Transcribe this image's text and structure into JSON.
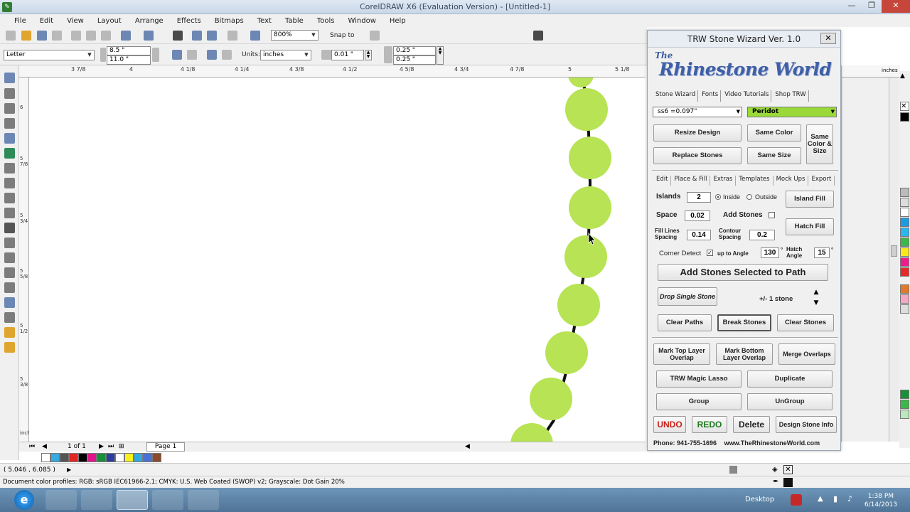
{
  "window": {
    "title": "CorelDRAW X6 (Evaluation Version) - [Untitled-1]",
    "minimize": "—",
    "maximize": "❐",
    "close": "✕"
  },
  "menu": [
    "File",
    "Edit",
    "View",
    "Layout",
    "Arrange",
    "Effects",
    "Bitmaps",
    "Text",
    "Table",
    "Tools",
    "Window",
    "Help"
  ],
  "toolbar": {
    "zoom": "800%",
    "snap_to": "Snap to",
    "page_size": "Letter",
    "width": "8.5 \"",
    "height": "11.0 \"",
    "units_label": "Units:",
    "units": "inches",
    "nudge": "0.01 \"",
    "dup_x": "0.25 \"",
    "dup_y": "0.25 \""
  },
  "ruler": {
    "h_ticks": [
      "3 7/8",
      "4",
      "4 1/8",
      "4 1/4",
      "4 3/8",
      "4 1/2",
      "4 5/8",
      "4 3/4",
      "4 7/8",
      "5",
      "5 1/8"
    ],
    "v_ticks": [
      "6",
      "5 7/8",
      "5 3/4",
      "5 5/8",
      "5 1/2",
      "5 3/8"
    ],
    "v_unit": "inches",
    "h_unit": "inches"
  },
  "page_nav": {
    "count": "1 of 1",
    "page_tab": "Page 1"
  },
  "status": {
    "coords": "( 5.046 , 6.085 )",
    "profile": "Document color profiles: RGB: sRGB IEC61966-2.1; CMYK: U.S. Web Coated (SWOP) v2; Grayscale: Dot Gain 20%"
  },
  "taskbar": {
    "desktop": "Desktop",
    "time": "1:38 PM",
    "date": "6/14/2013"
  },
  "wizard": {
    "title": "TRW Stone Wizard Ver. 1.0",
    "close": "✕",
    "logo_the": "The",
    "logo": "Rhinestone World",
    "tabs": [
      "Stone Wizard",
      "Fonts",
      "Video Tutorials",
      "Shop TRW"
    ],
    "stone_size": "ss6 =0.097\"",
    "stone_color": "Peridot",
    "buttons": {
      "resize_design": "Resize Design",
      "same_color": "Same Color",
      "same_color_size": "Same Color & Size",
      "replace_stones": "Replace Stones",
      "same_size": "Same Size",
      "island_fill": "Island Fill",
      "hatch_fill": "Hatch Fill",
      "add_stones_path": "Add Stones Selected to Path",
      "drop_single": "Drop Single Stone",
      "clear_paths": "Clear Paths",
      "break_stones": "Break Stones",
      "clear_stones": "Clear Stones",
      "mark_top": "Mark Top Layer Overlap",
      "mark_bottom": "Mark Bottom Layer Overlap",
      "merge_overlaps": "Merge Overlaps",
      "magic_lasso": "TRW Magic Lasso",
      "duplicate": "Duplicate",
      "group": "Group",
      "ungroup": "UnGroup",
      "undo": "UNDO",
      "redo": "REDO",
      "delete": "Delete",
      "design_info": "Design Stone Info"
    },
    "sub_tabs": [
      "Edit",
      "Place & Fill",
      "Extras",
      "Templates",
      "Mock Ups",
      "Export"
    ],
    "labels": {
      "islands": "Islands",
      "inside": "Inside",
      "outside": "Outside",
      "space": "Space",
      "add_stones": "Add Stones",
      "fill_lines": "Fill Lines Spacing",
      "contour": "Contour Spacing",
      "corner_detect": "Corner Detect",
      "up_to_angle": "up to Angle",
      "hatch_angle": "Hatch Angle",
      "plus_minus": "+/- 1 stone",
      "degree": "°"
    },
    "values": {
      "islands": "2",
      "space": "0.02",
      "fill_lines": "0.14",
      "contour": "0.2",
      "angle": "130",
      "hatch_angle": "15"
    },
    "footer_phone": "Phone: 941-755-1696",
    "footer_web": "www.TheRhinestoneWorld.com"
  },
  "colors": {
    "stone": "#b7e354",
    "peridot": "#9bd93a",
    "path": "#111111"
  }
}
